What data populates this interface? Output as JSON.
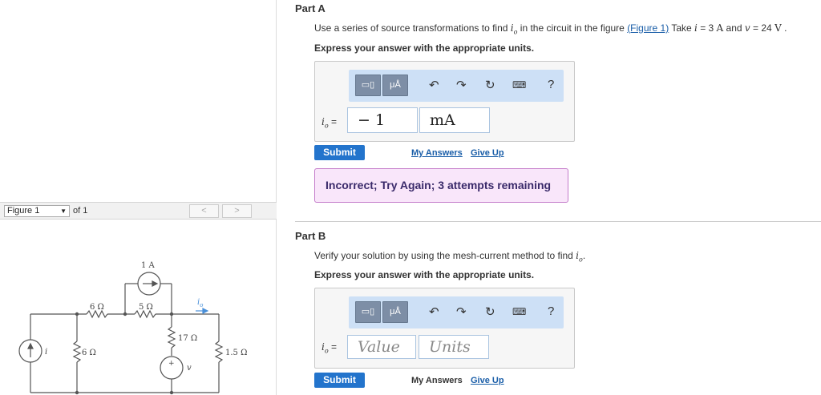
{
  "figure_panel": {
    "selector_value": "Figure 1",
    "of_label": "of 1",
    "prev_label": "<",
    "next_label": ">",
    "circuit_labels": {
      "current_source_top": "1 A",
      "r_6_top": "6 Ω",
      "r_5": "5 Ω",
      "r_6_left": "6 Ω",
      "r_17": "17 Ω",
      "r_15": "1.5 Ω",
      "src_i": "i",
      "src_v": "v",
      "io": "i",
      "io_sub": "o",
      "plus": "+"
    }
  },
  "part_a": {
    "title": "Part A",
    "question_pre": "Use a series of source transformations to find ",
    "question_var": "i",
    "question_var_sub": "o",
    "question_mid": " in the circuit in the figure ",
    "figure_link": "(Figure 1)",
    "question_take": " Take ",
    "take_i": "i",
    "take_i_val": " = 3 ",
    "take_i_unit": "A",
    "take_and": " and ",
    "take_v": "v",
    "take_v_val": " = 24 ",
    "take_v_unit": "V",
    "take_end": " .",
    "express": "Express your answer with the appropriate units.",
    "toolbar_units": "μÅ",
    "help": "?",
    "var_label": "i",
    "var_sub": "o",
    "var_eq": " =",
    "value": "− 1",
    "unit": "mA",
    "submit": "Submit",
    "my_answers": "My Answers",
    "give_up": "Give Up",
    "feedback": "Incorrect; Try Again; 3 attempts remaining"
  },
  "part_b": {
    "title": "Part B",
    "question_pre": "Verify your solution by using the mesh-current method to find ",
    "question_var": "i",
    "question_var_sub": "o",
    "question_end": ".",
    "express": "Express your answer with the appropriate units.",
    "toolbar_units": "μÅ",
    "help": "?",
    "var_label": "i",
    "var_sub": "o",
    "var_eq": " =",
    "value_placeholder": "Value",
    "unit_placeholder": "Units",
    "submit": "Submit",
    "my_answers": "My Answers",
    "give_up": "Give Up"
  },
  "colors": {
    "submit": "#2374cc",
    "link": "#1a5ea8",
    "toolbar_bg": "#cde0f6",
    "feedback_bg": "#f9e6fa",
    "feedback_border": "#c47cca"
  }
}
